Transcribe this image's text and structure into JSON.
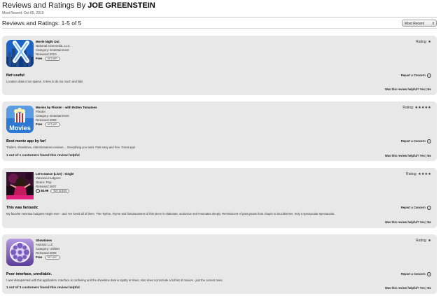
{
  "header": {
    "title_prefix": "Reviews and Ratings By ",
    "title_name": "JOE GREENSTEIN",
    "subtitle": "Most Recent: Oct 05, 2010"
  },
  "toolbar": {
    "title": "Reviews and Ratings: 1-5 of 5",
    "sort_value": "Most Recent"
  },
  "labels": {
    "report": "Report a Concern",
    "helpful": "Was this review helpful? Yes | No"
  },
  "reviews": [
    {
      "app_name": "Movie Night Out",
      "developer": "National Cinemedia, LLC",
      "category": "Category: Entertainment",
      "released": "Released 2010",
      "price": "Free",
      "button": "GET APP",
      "rating_label": "Rating:",
      "stars": "★",
      "title": "Not useful",
      "body": "Location data is too sparse. It tries to do too much and fails",
      "helpful_count": ""
    },
    {
      "app_name": "Movies by Flixster - with Rotten Tomatoes",
      "developer": "Flixster",
      "category": "Category: Entertainment",
      "released": "Released 2008",
      "price": "Free",
      "button": "GET APP",
      "rating_label": "Rating:",
      "stars": "★★★★★",
      "title": "Best movie app by far!",
      "body": "Trailers, showtimes, rottentomatoes reviews.... Everything you want. Fast easy and free. Great app!",
      "helpful_count": "1 out of 1 customers found this review helpful"
    },
    {
      "app_name": "Let's Dance (Live) - Single",
      "developer": "Vanessa Hudgens",
      "category": "Genre: Pop",
      "released": "Released 2007",
      "price": "$0.99",
      "button": "BUY ALBUM",
      "rating_label": "Rating:",
      "stars": "★★★★",
      "title": "This was fantastic",
      "body": "My favorite vanessa hudgens single ever - and I've loved all of them. The rhythm, rhyme and fortuitousness of this piece is elaborate, seductive and resonates deeply. Reminiscent of past greats from chopin to bruckheimer, truly a spectacular spectacular.",
      "helpful_count": ""
    },
    {
      "app_name": "Showtimes",
      "developer": "Avantaz LLC",
      "category": "Category: Utilities",
      "released": "Released 2008",
      "price": "Free",
      "button": "GET APP",
      "rating_label": "Rating:",
      "stars": "★",
      "title": "Poor interface, unreliable.",
      "body": "I was dissapointed with this application. Interface is confusing and the showtime data is spotty at times. Also does not include a full list of movies - just the current ones.",
      "helpful_count": "1 out of 3 customers found this review helpful"
    }
  ]
}
